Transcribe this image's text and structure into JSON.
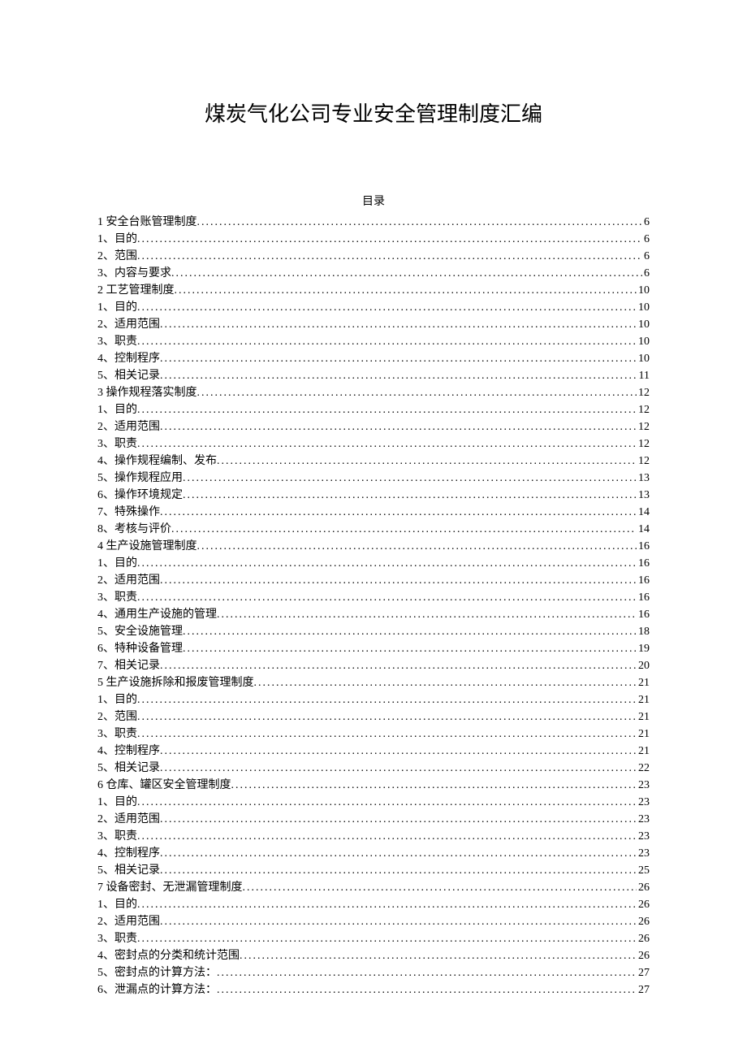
{
  "title": "煤炭气化公司专业安全管理制度汇编",
  "toc_label": "目录",
  "toc": [
    {
      "text": "1 安全台账管理制度",
      "page": "6"
    },
    {
      "text": "1、目的",
      "page": "6"
    },
    {
      "text": "2、范围",
      "page": "6"
    },
    {
      "text": "3、内容与要求",
      "page": "6"
    },
    {
      "text": "2 工艺管理制度",
      "page": "10"
    },
    {
      "text": "1、目的",
      "page": "10"
    },
    {
      "text": "2、适用范围",
      "page": "10"
    },
    {
      "text": "3、职责",
      "page": "10"
    },
    {
      "text": "4、控制程序",
      "page": "10"
    },
    {
      "text": "5、相关记录",
      "page": "11"
    },
    {
      "text": "3 操作规程落实制度",
      "page": "12"
    },
    {
      "text": "1、目的",
      "page": "12"
    },
    {
      "text": "2、适用范围",
      "page": "12"
    },
    {
      "text": "3、职责",
      "page": "12"
    },
    {
      "text": "4、操作规程编制、发布",
      "page": "12"
    },
    {
      "text": "5、操作规程应用",
      "page": "13"
    },
    {
      "text": "6、操作环境规定",
      "page": "13"
    },
    {
      "text": "7、特殊操作",
      "page": "14"
    },
    {
      "text": "8、考核与评价",
      "page": "14"
    },
    {
      "text": "4 生产设施管理制度",
      "page": "16"
    },
    {
      "text": "1、目的",
      "page": "16"
    },
    {
      "text": "2、适用范围",
      "page": "16"
    },
    {
      "text": "3、职责",
      "page": "16"
    },
    {
      "text": "4、通用生产设施的管理",
      "page": "16"
    },
    {
      "text": "5、安全设施管理",
      "page": "18"
    },
    {
      "text": "6、特种设备管理",
      "page": "19"
    },
    {
      "text": "7、相关记录",
      "page": "20"
    },
    {
      "text": "5 生产设施拆除和报废管理制度",
      "page": "21"
    },
    {
      "text": "1、目的",
      "page": "21"
    },
    {
      "text": "2、范围",
      "page": "21"
    },
    {
      "text": "3、职责",
      "page": "21"
    },
    {
      "text": "4、控制程序",
      "page": "21"
    },
    {
      "text": "5、相关记录",
      "page": "22"
    },
    {
      "text": "6 仓库、罐区安全管理制度",
      "page": "23"
    },
    {
      "text": "1、目的",
      "page": "23"
    },
    {
      "text": "2、适用范围",
      "page": "23"
    },
    {
      "text": "3、职责",
      "page": "23"
    },
    {
      "text": "4、控制程序",
      "page": "23"
    },
    {
      "text": "5、相关记录",
      "page": "25"
    },
    {
      "text": "7 设备密封、无泄漏管理制度",
      "page": "26"
    },
    {
      "text": "1、目的",
      "page": "26"
    },
    {
      "text": "2、适用范围",
      "page": "26"
    },
    {
      "text": "3、职责",
      "page": "26"
    },
    {
      "text": "4、密封点的分类和统计范围",
      "page": "26"
    },
    {
      "text": "5、密封点的计算方法：",
      "page": "27"
    },
    {
      "text": "6、泄漏点的计算方法：",
      "page": "27"
    }
  ]
}
